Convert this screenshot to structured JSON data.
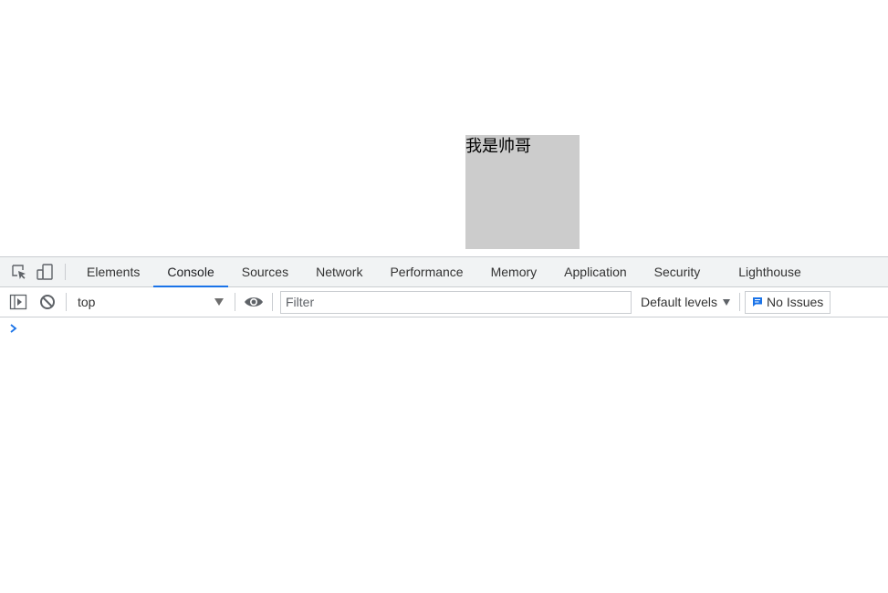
{
  "page": {
    "box_text": "我是帅哥"
  },
  "devtools": {
    "tabs": [
      {
        "label": "Elements",
        "active": false
      },
      {
        "label": "Console",
        "active": true
      },
      {
        "label": "Sources",
        "active": false
      },
      {
        "label": "Network",
        "active": false
      },
      {
        "label": "Performance",
        "active": false
      },
      {
        "label": "Memory",
        "active": false
      },
      {
        "label": "Application",
        "active": false
      },
      {
        "label": "Security",
        "active": false
      },
      {
        "label": "Lighthouse",
        "active": false
      }
    ],
    "console_toolbar": {
      "context": "top",
      "filter_placeholder": "Filter",
      "filter_value": "",
      "levels_label": "Default levels",
      "issues_label": "No Issues"
    }
  },
  "colors": {
    "accent": "#1a73e8",
    "box_bg": "#cccccc",
    "tabbar_bg": "#f1f3f4",
    "border": "#cacdd1"
  },
  "icons": {
    "inspect": "inspect-element-icon",
    "device": "device-toolbar-icon",
    "sidebar": "show-sidebar-icon",
    "clear": "clear-console-icon",
    "eye": "live-expression-icon",
    "issues": "issues-message-icon",
    "prompt": "console-prompt-chevron-icon"
  }
}
